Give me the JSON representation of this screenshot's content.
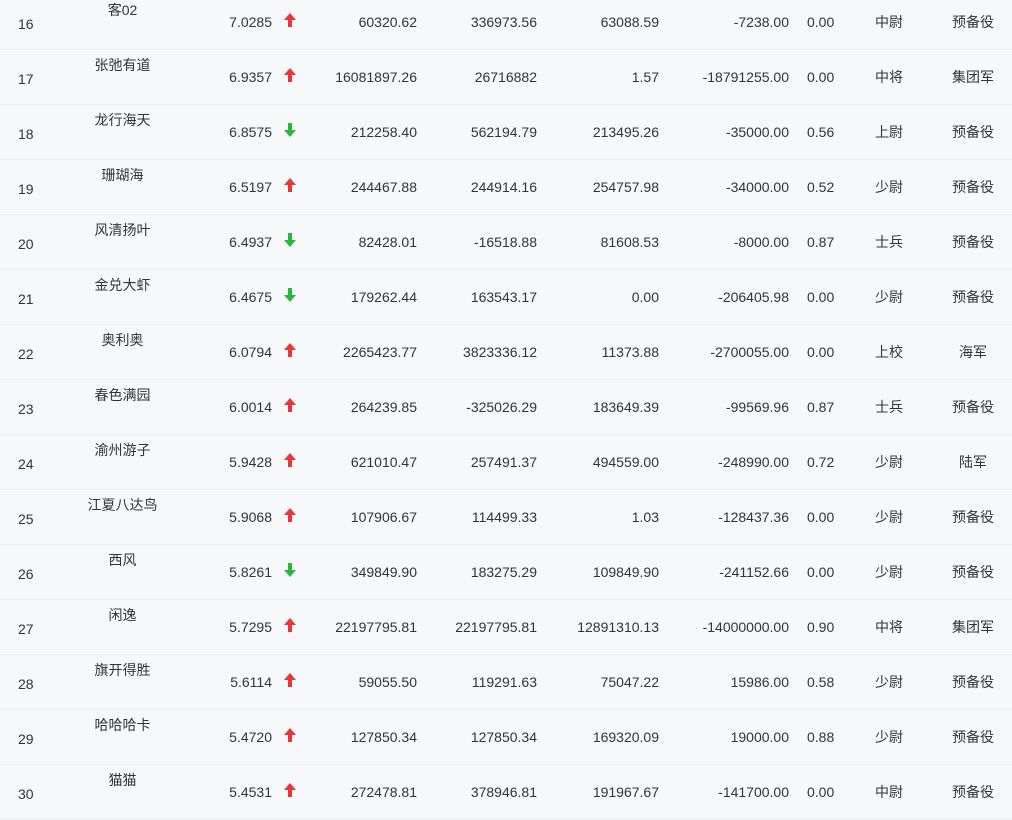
{
  "colors": {
    "up": "#e4393c",
    "down": "#2fb344"
  },
  "rows": [
    {
      "rank": "16",
      "name": "客02",
      "score": "7.0285",
      "trend": "up",
      "v1": "60320.62",
      "v2": "336973.56",
      "v3": "63088.59",
      "v4": "-7238.00",
      "v5": "0.00",
      "title": "中尉",
      "unit": "预备役"
    },
    {
      "rank": "17",
      "name": "张弛有道",
      "score": "6.9357",
      "trend": "up",
      "v1": "16081897.26",
      "v2": "26716882",
      "v3": "1.57",
      "v4": "-18791255.00",
      "v5": "0.00",
      "title": "中将",
      "unit": "集团军"
    },
    {
      "rank": "18",
      "name": "龙行海天",
      "score": "6.8575",
      "trend": "down",
      "v1": "212258.40",
      "v2": "562194.79",
      "v3": "213495.26",
      "v4": "-35000.00",
      "v5": "0.56",
      "title": "上尉",
      "unit": "预备役"
    },
    {
      "rank": "19",
      "name": "珊瑚海",
      "score": "6.5197",
      "trend": "up",
      "v1": "244467.88",
      "v2": "244914.16",
      "v3": "254757.98",
      "v4": "-34000.00",
      "v5": "0.52",
      "title": "少尉",
      "unit": "预备役"
    },
    {
      "rank": "20",
      "name": "风清扬叶",
      "score": "6.4937",
      "trend": "down",
      "v1": "82428.01",
      "v2": "-16518.88",
      "v3": "81608.53",
      "v4": "-8000.00",
      "v5": "0.87",
      "title": "士兵",
      "unit": "预备役"
    },
    {
      "rank": "21",
      "name": "金兑大虾",
      "score": "6.4675",
      "trend": "down",
      "v1": "179262.44",
      "v2": "163543.17",
      "v3": "0.00",
      "v4": "-206405.98",
      "v5": "0.00",
      "title": "少尉",
      "unit": "预备役"
    },
    {
      "rank": "22",
      "name": "奥利奥",
      "score": "6.0794",
      "trend": "up",
      "v1": "2265423.77",
      "v2": "3823336.12",
      "v3": "11373.88",
      "v4": "-2700055.00",
      "v5": "0.00",
      "title": "上校",
      "unit": "海军"
    },
    {
      "rank": "23",
      "name": "春色满园",
      "score": "6.0014",
      "trend": "up",
      "v1": "264239.85",
      "v2": "-325026.29",
      "v3": "183649.39",
      "v4": "-99569.96",
      "v5": "0.87",
      "title": "士兵",
      "unit": "预备役"
    },
    {
      "rank": "24",
      "name": "渝州游子",
      "score": "5.9428",
      "trend": "up",
      "v1": "621010.47",
      "v2": "257491.37",
      "v3": "494559.00",
      "v4": "-248990.00",
      "v5": "0.72",
      "title": "少尉",
      "unit": "陆军"
    },
    {
      "rank": "25",
      "name": "江夏八达鸟",
      "score": "5.9068",
      "trend": "up",
      "v1": "107906.67",
      "v2": "114499.33",
      "v3": "1.03",
      "v4": "-128437.36",
      "v5": "0.00",
      "title": "少尉",
      "unit": "预备役"
    },
    {
      "rank": "26",
      "name": "西风",
      "score": "5.8261",
      "trend": "down",
      "v1": "349849.90",
      "v2": "183275.29",
      "v3": "109849.90",
      "v4": "-241152.66",
      "v5": "0.00",
      "title": "少尉",
      "unit": "预备役"
    },
    {
      "rank": "27",
      "name": "闲逸",
      "score": "5.7295",
      "trend": "up",
      "v1": "22197795.81",
      "v2": "22197795.81",
      "v3": "12891310.13",
      "v4": "-14000000.00",
      "v5": "0.90",
      "title": "中将",
      "unit": "集团军"
    },
    {
      "rank": "28",
      "name": "旗开得胜",
      "score": "5.6114",
      "trend": "up",
      "v1": "59055.50",
      "v2": "119291.63",
      "v3": "75047.22",
      "v4": "15986.00",
      "v5": "0.58",
      "title": "少尉",
      "unit": "预备役"
    },
    {
      "rank": "29",
      "name": "哈哈哈卡",
      "score": "5.4720",
      "trend": "up",
      "v1": "127850.34",
      "v2": "127850.34",
      "v3": "169320.09",
      "v4": "19000.00",
      "v5": "0.88",
      "title": "少尉",
      "unit": "预备役"
    },
    {
      "rank": "30",
      "name": "猫猫",
      "score": "5.4531",
      "trend": "up",
      "v1": "272478.81",
      "v2": "378946.81",
      "v3": "191967.67",
      "v4": "-141700.00",
      "v5": "0.00",
      "title": "中尉",
      "unit": "预备役"
    }
  ]
}
